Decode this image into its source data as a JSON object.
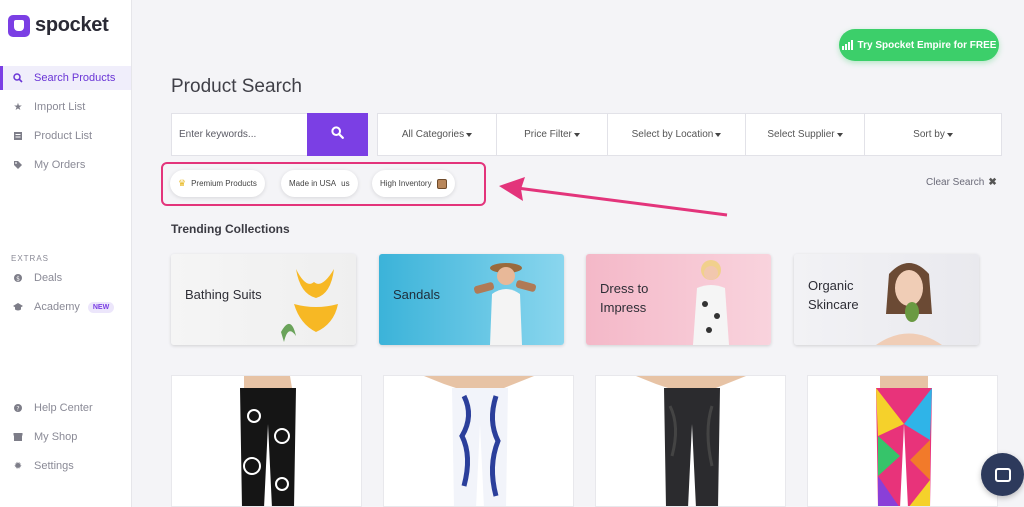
{
  "brand": {
    "name": "spocket",
    "accent": "#7b3fe4"
  },
  "sidebar": {
    "main_items": [
      {
        "label": "Search Products",
        "icon": "search-icon",
        "active": true
      },
      {
        "label": "Import List",
        "icon": "star-icon"
      },
      {
        "label": "Product List",
        "icon": "list-icon"
      },
      {
        "label": "My Orders",
        "icon": "tag-icon"
      }
    ],
    "extras_label": "EXTRAS",
    "extras_items": [
      {
        "label": "Deals",
        "icon": "deals-icon"
      },
      {
        "label": "Academy",
        "icon": "academy-icon",
        "badge": "NEW"
      }
    ],
    "footer_items": [
      {
        "label": "Help Center",
        "icon": "help-icon"
      },
      {
        "label": "My Shop",
        "icon": "shop-icon"
      },
      {
        "label": "Settings",
        "icon": "gear-icon"
      }
    ]
  },
  "header": {
    "cta_label": "Try Spocket Empire for FREE",
    "cta_color": "#3ccf6a"
  },
  "page_title": "Product Search",
  "search": {
    "placeholder": "Enter keywords...",
    "value": "",
    "filters": [
      "All Categories",
      "Price Filter",
      "Select by Location",
      "Select Supplier",
      "Sort by"
    ]
  },
  "chips": [
    {
      "label": "Premium Products",
      "icon": "crown-icon"
    },
    {
      "label": "Made in USA",
      "suffix": "us"
    },
    {
      "label": "High Inventory",
      "icon": "box-icon"
    }
  ],
  "highlight_color": "#e3347b",
  "clear_search_label": "Clear Search",
  "trending": {
    "title": "Trending Collections",
    "collections": [
      {
        "label_lines": [
          "Bathing Suits"
        ]
      },
      {
        "label_lines": [
          "Sandals"
        ]
      },
      {
        "label_lines": [
          "Dress to",
          "Impress"
        ]
      },
      {
        "label_lines": [
          "Organic",
          "Skincare"
        ]
      }
    ]
  },
  "products": [
    {
      "name": "black-paisley-leggings"
    },
    {
      "name": "blue-white-pattern-leggings"
    },
    {
      "name": "dark-grey-leggings"
    },
    {
      "name": "rainbow-geometric-leggings"
    }
  ]
}
